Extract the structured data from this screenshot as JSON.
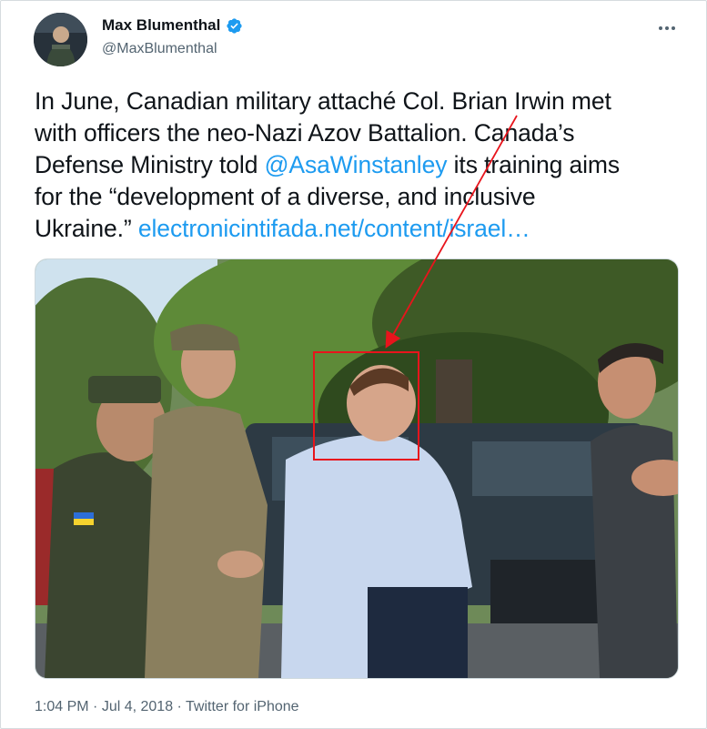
{
  "author": {
    "name": "Max Blumenthal",
    "handle": "@MaxBlumenthal",
    "verified": true,
    "verified_color": "#1d9bf0"
  },
  "menu_icon": "more-horizontal-icon",
  "tweet": {
    "lines": [
      "In June, Canadian military attaché Col. Brian Irwin met",
      "with officers the neo-Nazi Azov Battalion. Canada’s",
      "its training aims",
      "for the “development of a diverse, and inclusive",
      "Ukraine.”"
    ],
    "line3_prefix": "Defense Ministry told ",
    "mention": "@AsaWinstanley",
    "link": "electronicintifada.net/content/israel…"
  },
  "media": {
    "photo_icon": "photo-image",
    "annotation": {
      "box_color": "#e8141c",
      "arrow_color": "#e8141c"
    }
  },
  "footer": {
    "time": "1:04 PM",
    "sep": " · ",
    "date": "Jul 4, 2018",
    "client": "Twitter for iPhone"
  },
  "colors": {
    "link": "#1d9bf0",
    "text": "#0f1419",
    "secondary": "#536471"
  }
}
